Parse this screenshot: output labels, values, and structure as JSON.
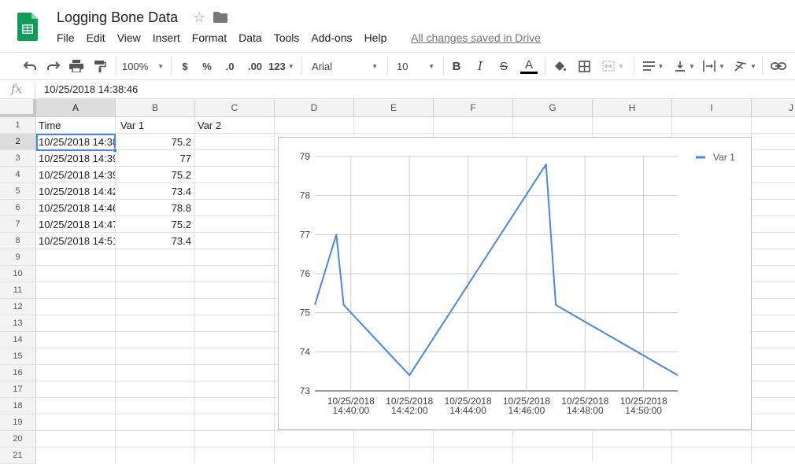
{
  "doc": {
    "title": "Logging Bone Data",
    "saved_status": "All changes saved in Drive"
  },
  "menu": [
    "File",
    "Edit",
    "View",
    "Insert",
    "Format",
    "Data",
    "Tools",
    "Add-ons",
    "Help"
  ],
  "toolbar": {
    "zoom": "100%",
    "currency": "$",
    "percent": "%",
    "decrease_decimal": ".0",
    "increase_decimal": ".00",
    "more_formats": "123",
    "font": "Arial",
    "font_size": "10",
    "bold": "B",
    "italic": "I",
    "strike": "S",
    "text_color": "A"
  },
  "formula_bar": {
    "label": "fx",
    "value": "10/25/2018 14:38:46"
  },
  "columns": [
    "A",
    "B",
    "C",
    "D",
    "E",
    "F",
    "G",
    "H",
    "I",
    "J"
  ],
  "rows": [
    "1",
    "2",
    "3",
    "4",
    "5",
    "6",
    "7",
    "8",
    "9",
    "10",
    "11",
    "12",
    "13",
    "14",
    "15",
    "16",
    "17",
    "18",
    "19",
    "20",
    "21"
  ],
  "cells": {
    "header": [
      "Time",
      "Var 1",
      "Var 2"
    ],
    "data": [
      [
        "10/25/2018 14:38",
        "75.2"
      ],
      [
        "10/25/2018 14:39",
        "77"
      ],
      [
        "10/25/2018 14:39",
        "75.2"
      ],
      [
        "10/25/2018 14:42",
        "73.4"
      ],
      [
        "10/25/2018 14:46",
        "78.8"
      ],
      [
        "10/25/2018 14:47",
        "75.2"
      ],
      [
        "10/25/2018 14:51",
        "73.4"
      ]
    ]
  },
  "colors": {
    "series": "#4a86e8",
    "selection": "#4285f4",
    "logo": "#0f9d58"
  },
  "chart_data": {
    "type": "line",
    "series": [
      {
        "name": "Var 1",
        "x": [
          "2018-10-25 14:38:46",
          "2018-10-25 14:39:30",
          "2018-10-25 14:39:45",
          "2018-10-25 14:42:00",
          "2018-10-25 14:46:40",
          "2018-10-25 14:47:00",
          "2018-10-25 14:51:10"
        ],
        "y": [
          75.2,
          77,
          75.2,
          73.4,
          78.8,
          75.2,
          73.4
        ]
      }
    ],
    "x_ticks": [
      {
        "t": "2018-10-25 14:40:00",
        "line1": "10/25/2018",
        "line2": "14:40:00"
      },
      {
        "t": "2018-10-25 14:42:00",
        "line1": "10/25/2018",
        "line2": "14:42:00"
      },
      {
        "t": "2018-10-25 14:44:00",
        "line1": "10/25/2018",
        "line2": "14:44:00"
      },
      {
        "t": "2018-10-25 14:46:00",
        "line1": "10/25/2018",
        "line2": "14:46:00"
      },
      {
        "t": "2018-10-25 14:48:00",
        "line1": "10/25/2018",
        "line2": "14:48:00"
      },
      {
        "t": "2018-10-25 14:50:00",
        "line1": "10/25/2018",
        "line2": "14:50:00"
      }
    ],
    "xlim": [
      "2018-10-25 14:38:46",
      "2018-10-25 14:51:10"
    ],
    "ylim": [
      73,
      79
    ],
    "y_ticks": [
      73,
      74,
      75,
      76,
      77,
      78,
      79
    ],
    "legend_position": "top-right",
    "grid": true
  }
}
